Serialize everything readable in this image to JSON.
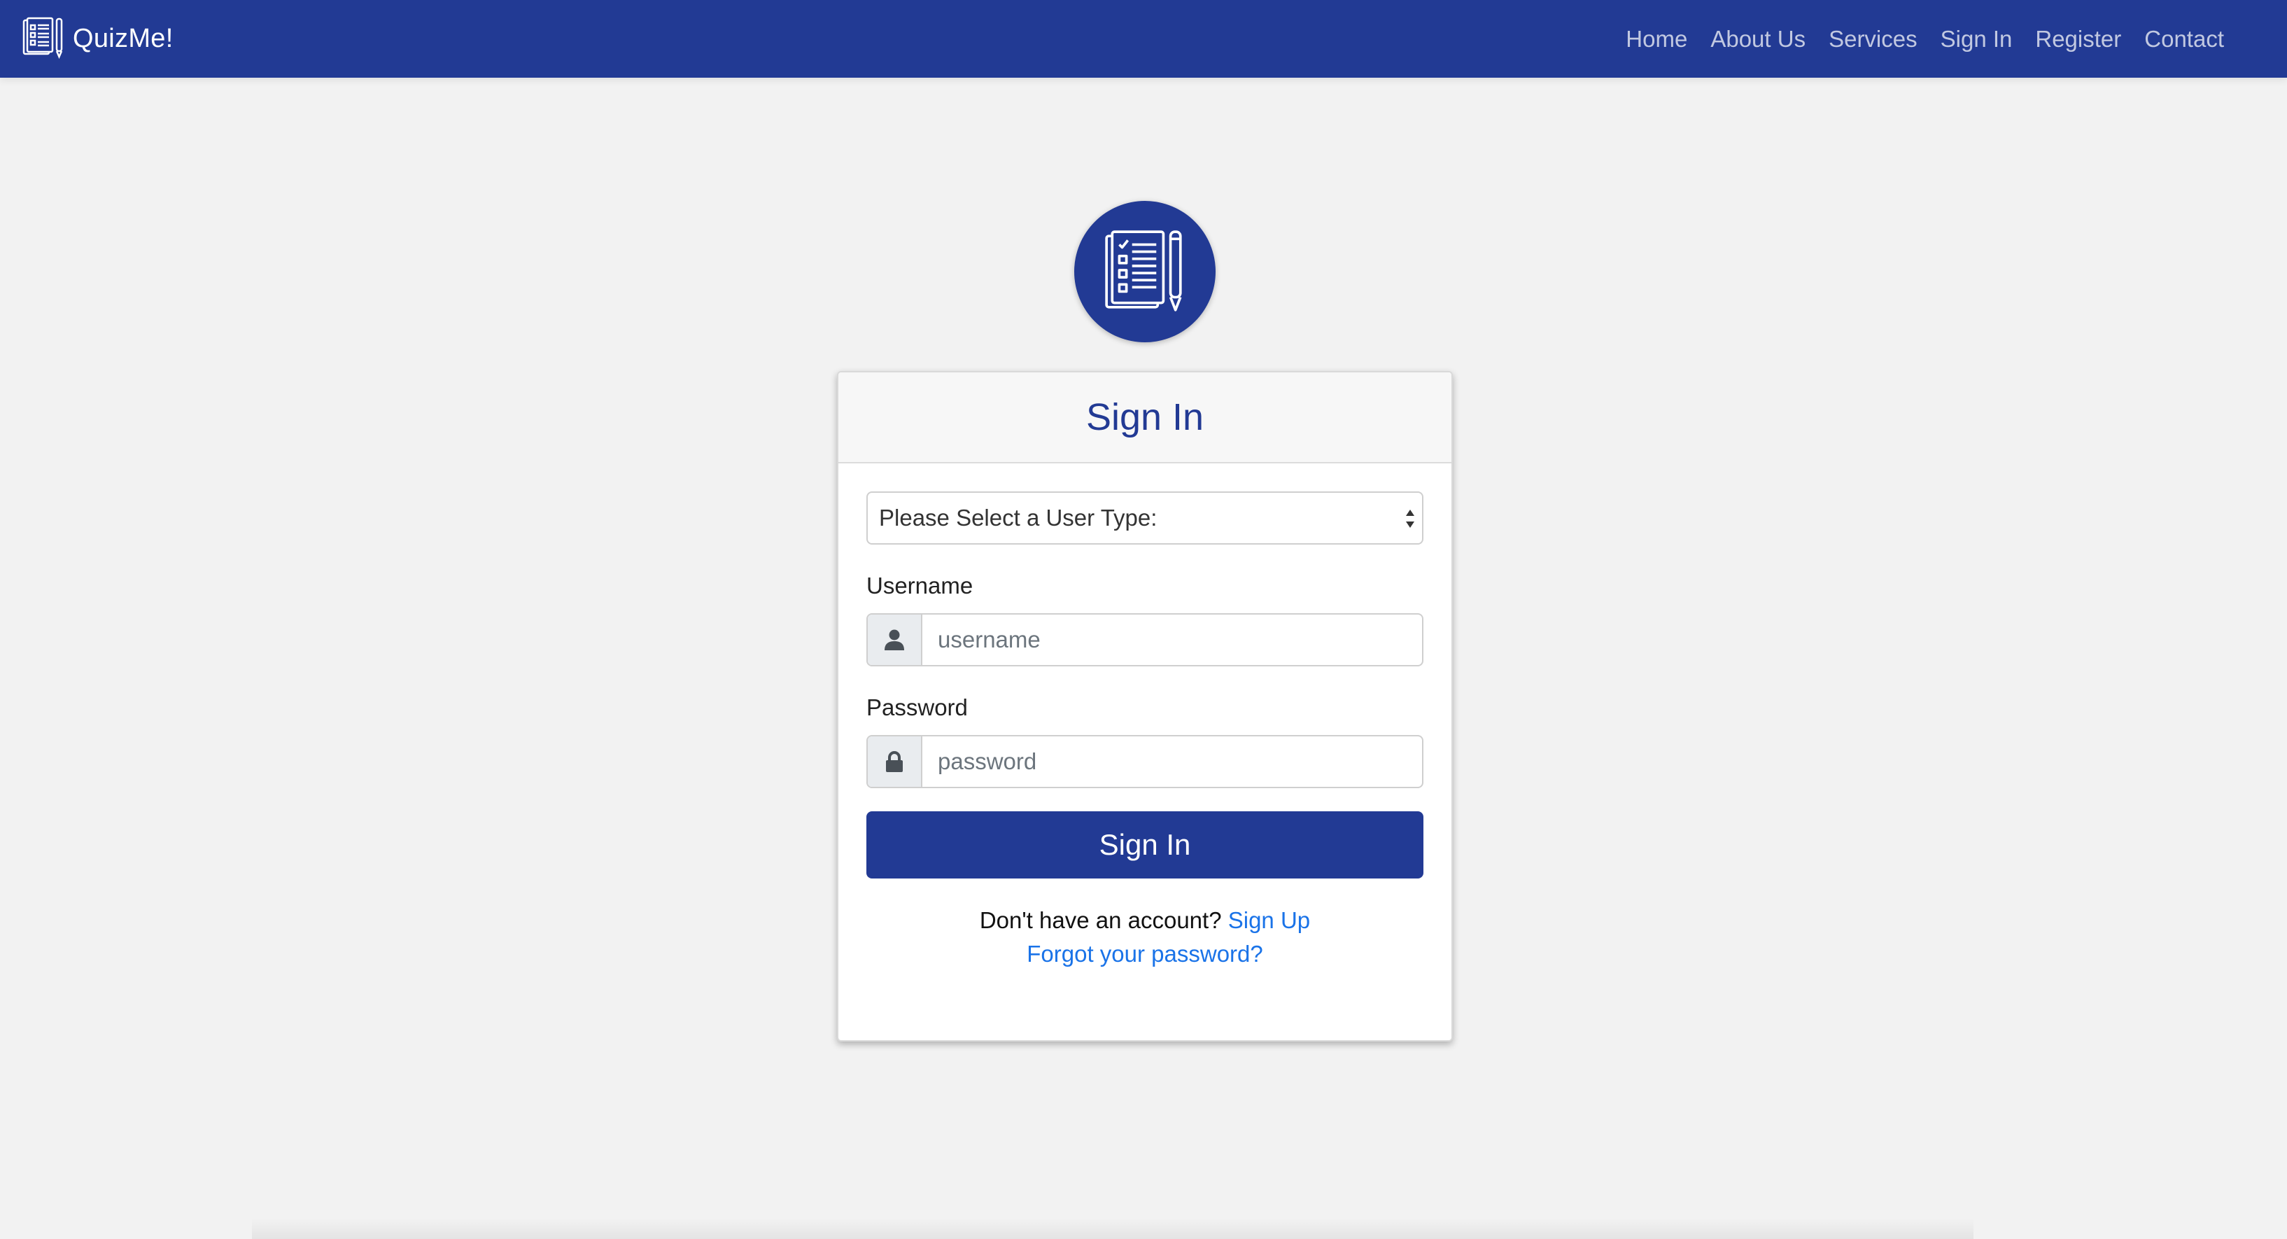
{
  "brand": {
    "name": "QuizMe!",
    "logo_icon": "quiz-checklist-icon"
  },
  "nav": {
    "items": [
      {
        "label": "Home"
      },
      {
        "label": "About Us"
      },
      {
        "label": "Services"
      },
      {
        "label": "Sign In"
      },
      {
        "label": "Register"
      },
      {
        "label": "Contact"
      }
    ]
  },
  "hero": {
    "icon": "quiz-checklist-icon"
  },
  "login": {
    "title": "Sign In",
    "user_type": {
      "selected": "Please Select a User Type:"
    },
    "username": {
      "label": "Username",
      "placeholder": "username",
      "icon": "user-icon"
    },
    "password": {
      "label": "Password",
      "placeholder": "password",
      "icon": "lock-icon"
    },
    "submit_label": "Sign In",
    "no_account_text": "Don't have an account?",
    "signup_link": "Sign Up",
    "forgot_link": "Forgot your password?"
  },
  "colors": {
    "primary": "#223a94",
    "background": "#f2f2f2",
    "link": "#1a73e8"
  }
}
